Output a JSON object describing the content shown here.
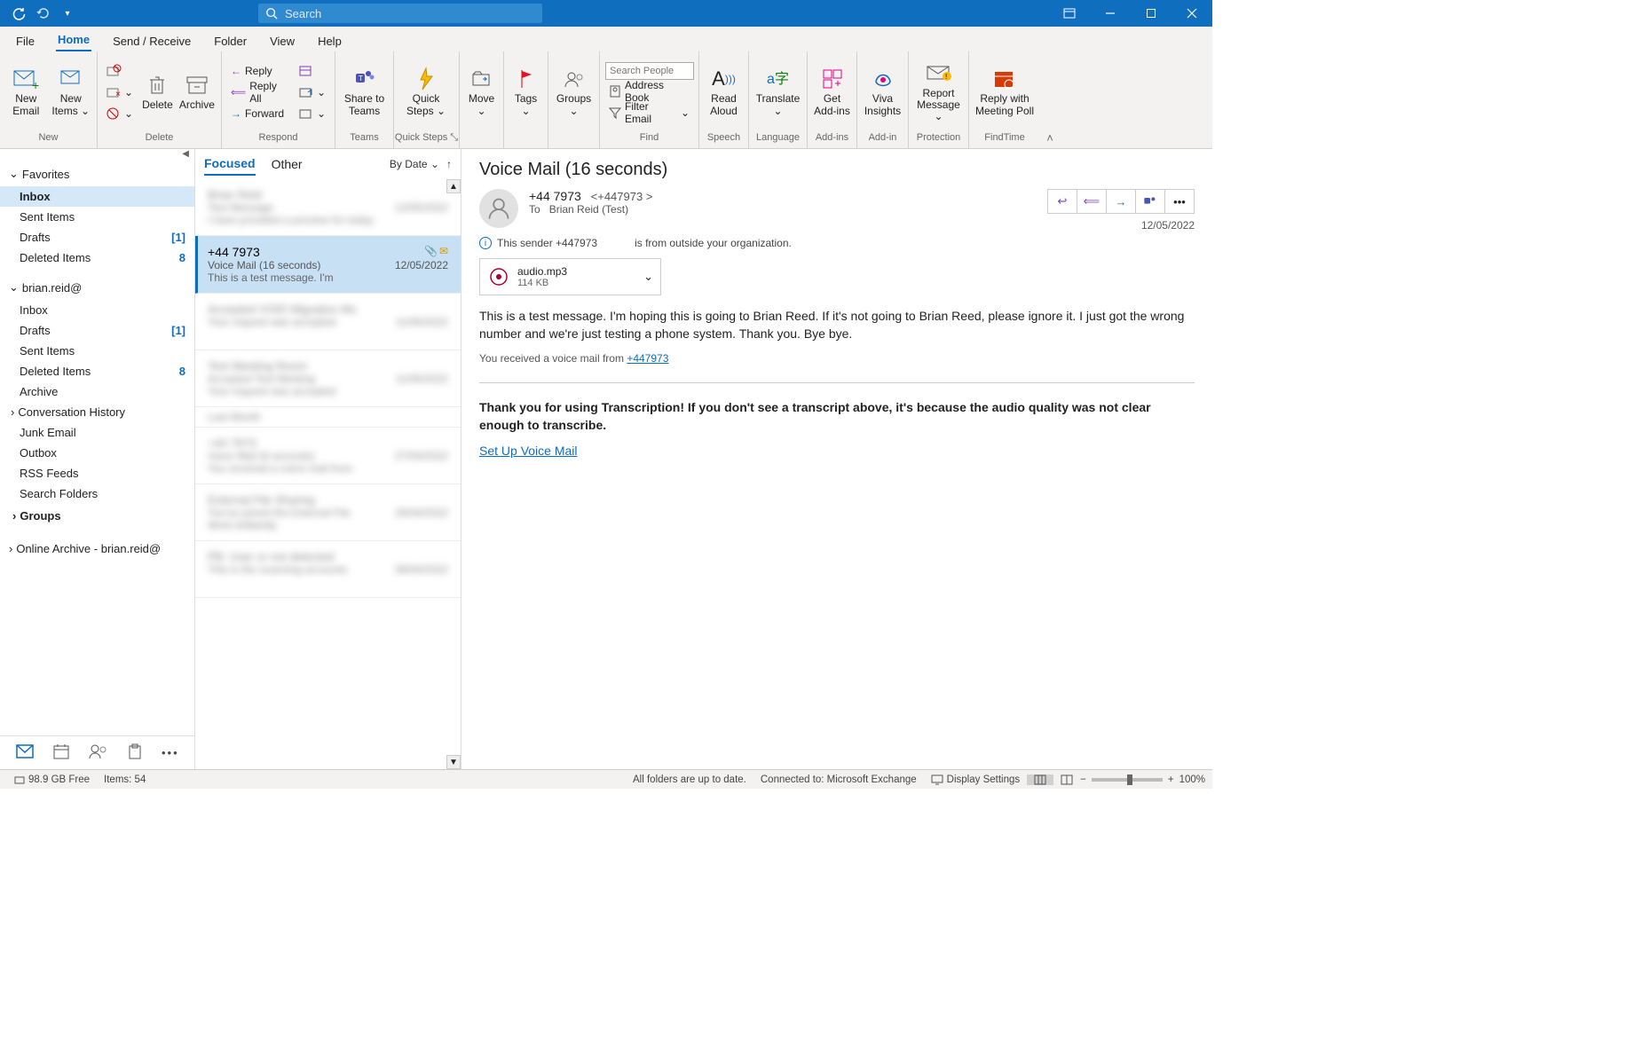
{
  "titlebar": {
    "search_placeholder": "Search"
  },
  "menu": {
    "file": "File",
    "home": "Home",
    "send_receive": "Send / Receive",
    "folder": "Folder",
    "view": "View",
    "help": "Help"
  },
  "ribbon": {
    "new_email": "New Email",
    "new_items": "New Items",
    "new_group": "New",
    "delete": "Delete",
    "archive": "Archive",
    "delete_group": "Delete",
    "reply": "Reply",
    "reply_all": "Reply All",
    "forward": "Forward",
    "respond_group": "Respond",
    "share_teams": "Share to Teams",
    "teams_group": "Teams",
    "quick_steps": "Quick Steps",
    "quick_steps_group": "Quick Steps",
    "move": "Move",
    "tags": "Tags",
    "groups": "Groups",
    "search_people_placeholder": "Search People",
    "address_book": "Address Book",
    "filter_email": "Filter Email",
    "find_group": "Find",
    "read_aloud": "Read Aloud",
    "speech_group": "Speech",
    "translate": "Translate",
    "language_group": "Language",
    "get_addins": "Get Add-ins",
    "addins_group": "Add-ins",
    "viva_insights": "Viva Insights",
    "addin_group": "Add-in",
    "report_message": "Report Message",
    "protection_group": "Protection",
    "reply_meeting_poll": "Reply with Meeting Poll",
    "findtime_group": "FindTime"
  },
  "nav": {
    "favorites": "Favorites",
    "inbox": "Inbox",
    "sent_items": "Sent Items",
    "drafts": "Drafts",
    "drafts_count": "[1]",
    "deleted_items": "Deleted Items",
    "deleted_count": "8",
    "account": "brian.reid@",
    "inbox2": "Inbox",
    "drafts2": "Drafts",
    "drafts2_count": "[1]",
    "sent_items2": "Sent Items",
    "deleted_items2": "Deleted Items",
    "deleted2_count": "8",
    "archive": "Archive",
    "conv_history": "Conversation History",
    "junk": "Junk Email",
    "outbox": "Outbox",
    "rss": "RSS Feeds",
    "search_folders": "Search Folders",
    "groups": "Groups",
    "online_archive": "Online Archive - brian.reid@"
  },
  "mlist": {
    "focused": "Focused",
    "other": "Other",
    "by_date": "By Date",
    "selected": {
      "from": "+44 7973",
      "subject": "Voice Mail (16 seconds)",
      "date": "12/05/2022",
      "snippet": "This is a test message. I'm"
    }
  },
  "reading": {
    "subject": "Voice Mail (16 seconds)",
    "from_name": "+44 7973",
    "from_addr": "<+447973             >",
    "to_label": "To",
    "to_value": "Brian Reid (Test)",
    "date": "12/05/2022",
    "external_left": "This sender +447973",
    "external_right": "is from outside your organization.",
    "attachment_name": "audio.mp3",
    "attachment_size": "114 KB",
    "body_p1": "This is a test message. I'm hoping this is going to Brian Reed. If it's not going to Brian Reed, please ignore it. I just got the wrong number and we're just testing a phone system. Thank you. Bye bye.",
    "body_p2_a": "You received a voice mail from ",
    "body_p2_link": "+447973",
    "body_p3": "Thank you for using Transcription! If you don't see a transcript above, it's because the audio quality was not clear enough to transcribe.",
    "setup_link": "Set Up Voice Mail"
  },
  "status": {
    "free": "98.9 GB Free",
    "items": "Items: 54",
    "sync": "All folders are up to date.",
    "connected": "Connected to: Microsoft Exchange",
    "display_settings": "Display Settings",
    "zoom": "100%"
  }
}
